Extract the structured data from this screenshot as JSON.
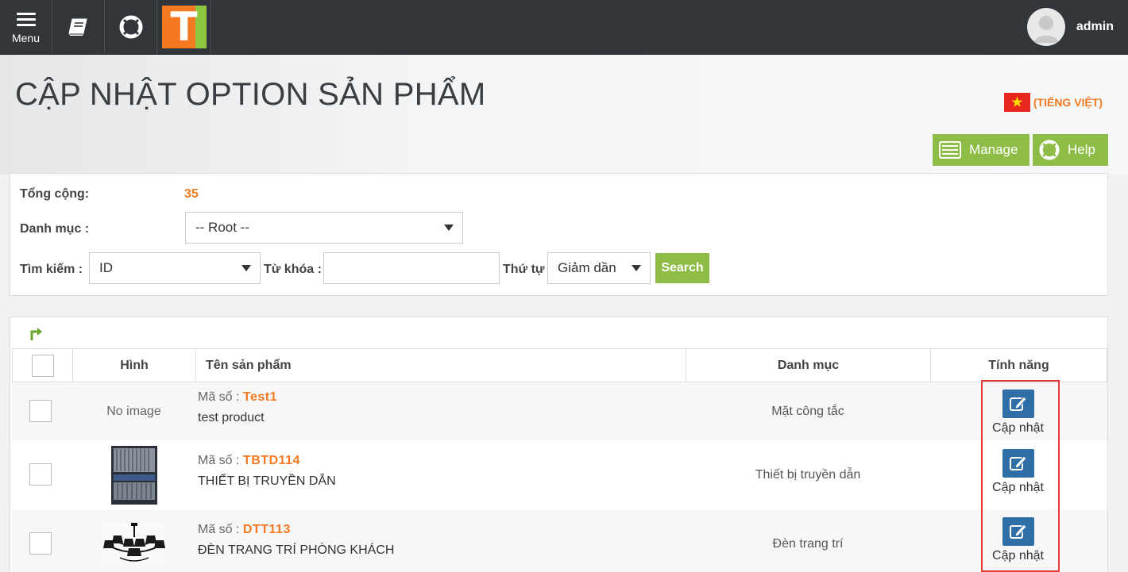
{
  "topbar": {
    "menu_label": "Menu",
    "user_name": "admin"
  },
  "header": {
    "title": "CẬP NHẬT OPTION SẢN PHẨM",
    "language": "(TIẾNG VIỆT)",
    "manage_label": "Manage",
    "help_label": "Help"
  },
  "filter": {
    "total_label": "Tổng cộng:",
    "total_value": "35",
    "category_label": "Danh mục :",
    "category_value": "-- Root --",
    "search_label": "Tìm kiếm :",
    "search_field_value": "ID",
    "keyword_label": "Từ khóa :",
    "keyword_value": "",
    "order_label": "Thứ tự",
    "order_value": "Giảm dần",
    "search_button": "Search"
  },
  "table": {
    "columns": [
      "Hình",
      "Tên sản phẩm",
      "Danh mục",
      "Tính năng"
    ],
    "code_prefix": "Mã số :",
    "action_label": "Cập nhật",
    "rows": [
      {
        "image": "No image",
        "code": "Test1",
        "name": "test product",
        "category": "Mặt công tắc"
      },
      {
        "image": "transmission-device-photo",
        "code": "TBTD114",
        "name": "THIẾT BỊ TRUYỀN DẪN",
        "category": "Thiết bị truyền dẫn"
      },
      {
        "image": "chandelier-photo",
        "code": "DTT113",
        "name": "ĐÈN TRANG TRÍ PHÒNG KHÁCH",
        "category": "Đèn trang trí"
      }
    ]
  },
  "colors": {
    "topbar": "#32363b",
    "accent_green": "#8dbd46",
    "accent_orange": "#f47920",
    "edit_blue": "#2f6ea6",
    "highlight_red": "#e53935"
  }
}
